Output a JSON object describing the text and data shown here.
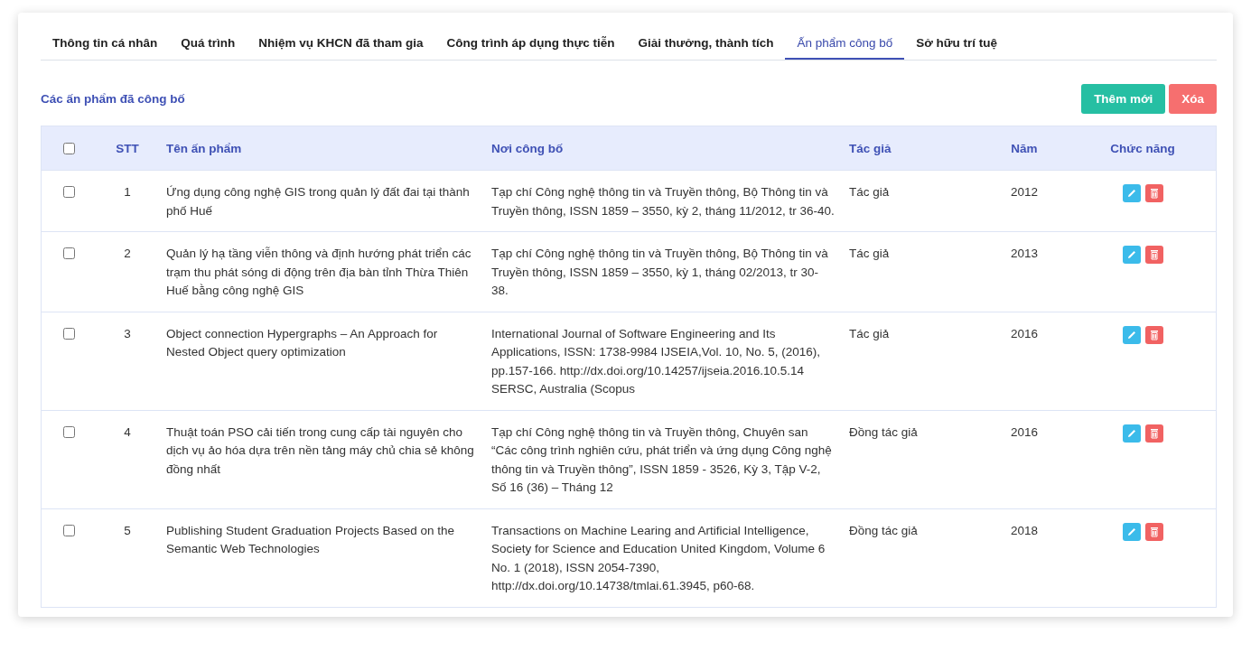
{
  "tabs": [
    {
      "label": "Thông tin cá nhân",
      "selected": false
    },
    {
      "label": "Quá trình",
      "selected": false
    },
    {
      "label": "Nhiệm vụ KHCN đã tham gia",
      "selected": false
    },
    {
      "label": "Công trình áp dụng thực tiễn",
      "selected": false
    },
    {
      "label": "Giải thưởng, thành tích",
      "selected": false
    },
    {
      "label": "Ấn phẩm công bố",
      "selected": true
    },
    {
      "label": "Sở hữu trí tuệ",
      "selected": false
    }
  ],
  "section_title": "Các ấn phẩm đã công bố",
  "buttons": [
    {
      "label": "Thêm mới",
      "kind": "add"
    },
    {
      "label": "Xóa",
      "kind": "delete"
    }
  ],
  "table": {
    "select_all_checked": false,
    "columns": [
      "STT",
      "Tên ấn phẩm",
      "Nơi công bố",
      "Tác giả",
      "Năm",
      "Chức năng"
    ],
    "rows": [
      {
        "checked": false,
        "stt": "1",
        "title": "Ứng dụng công nghệ GIS trong quản lý đất đai tại thành phố Huế",
        "venue": "Tạp chí Công nghệ thông tin và Truyền thông, Bộ Thông tin và Truyền thông, ISSN 1859 – 3550, kỳ 2, tháng 11/2012, tr 36-40.",
        "author": "Tác giả",
        "year": "2012"
      },
      {
        "checked": false,
        "stt": "2",
        "title": "Quản lý hạ tầng viễn thông và định hướng phát triển các trạm thu phát sóng di động trên địa bàn tỉnh Thừa Thiên Huế bằng công nghệ GIS",
        "venue": "Tạp chí Công nghệ thông tin và Truyền thông, Bộ Thông tin và Truyền thông, ISSN 1859 – 3550, kỳ 1, tháng 02/2013, tr 30-38.",
        "author": "Tác giả",
        "year": "2013"
      },
      {
        "checked": false,
        "stt": "3",
        "title": "Object connection Hypergraphs – An Approach for Nested Object query optimization",
        "venue": "International Journal of Software Engineering and Its Applications, ISSN: 1738-9984 IJSEIA,Vol. 10, No. 5, (2016), pp.157-166.  http://dx.doi.org/10.14257/ijseia.2016.10.5.14 SERSC, Australia (Scopus",
        "author": "Tác giả",
        "year": "2016"
      },
      {
        "checked": false,
        "stt": "4",
        "title": "Thuật toán PSO cải tiến trong cung cấp tài nguyên cho dịch vụ ảo hóa dựa trên nền tảng máy chủ chia sẻ không đồng nhất",
        "venue": "Tạp chí Công nghệ thông tin và Truyền thông, Chuyên san “Các công trình nghiên cứu, phát triển và ứng dụng Công nghệ thông tin và  Truyền thông”, ISSN 1859 - 3526, Kỳ 3, Tập V-2, Số 16 (36) – Tháng 12",
        "author": "Đồng tác giả",
        "year": "2016"
      },
      {
        "checked": false,
        "stt": "5",
        "title": "Publishing Student Graduation Projects Based on the Semantic Web Technologies",
        "venue": "Transactions on Machine Learing and Artificial Intelligence, Society for Science and Education United Kingdom, Volume 6 No. 1 (2018), ISSN 2054-7390, http://dx.doi.org/10.14738/tmlai.61.3945, p60-68.",
        "author": "Đồng tác giả",
        "year": "2018"
      }
    ]
  }
}
